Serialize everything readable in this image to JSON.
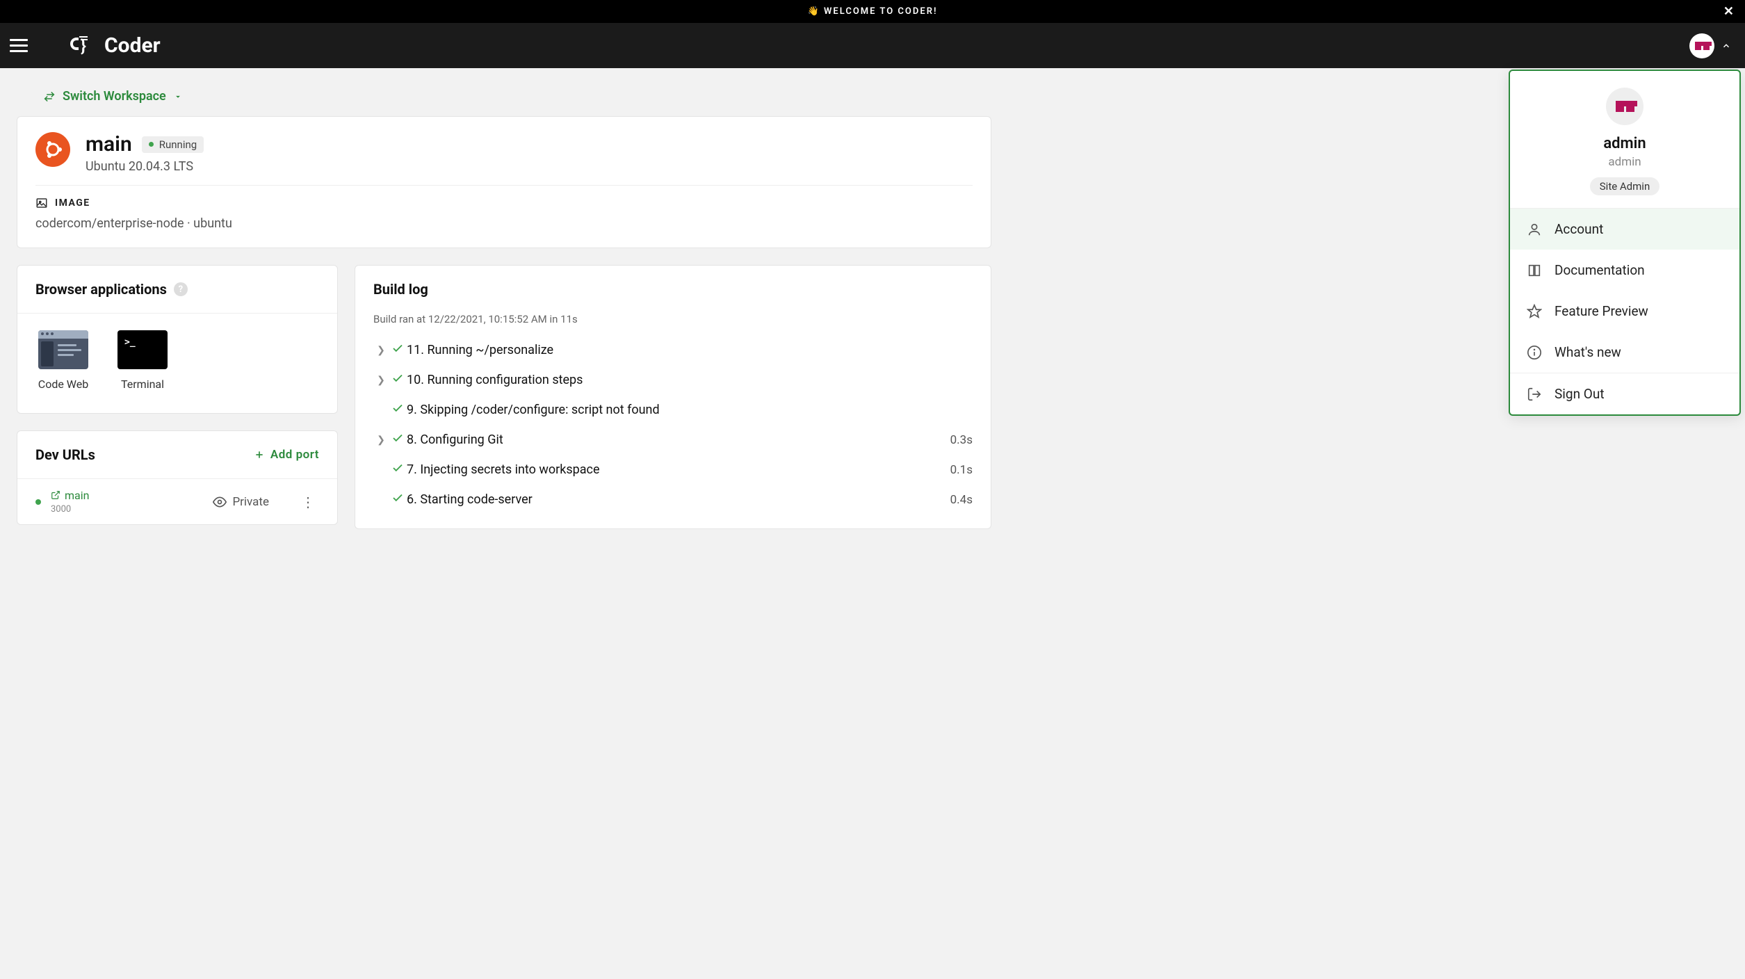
{
  "welcome_bar": {
    "emoji": "👋",
    "text": "WELCOME TO CODER!"
  },
  "brand": "Coder",
  "switch_workspace_label": "Switch Workspace",
  "workspace": {
    "name": "main",
    "status": "Running",
    "os": "Ubuntu 20.04.3 LTS",
    "image_label": "IMAGE",
    "image_value": "codercom/enterprise-node · ubuntu"
  },
  "browser_apps": {
    "title": "Browser applications",
    "items": [
      {
        "label": "Code Web"
      },
      {
        "label": "Terminal"
      }
    ]
  },
  "dev_urls": {
    "title": "Dev URLs",
    "add_label": "Add port",
    "items": [
      {
        "name": "main",
        "port": "3000",
        "privacy": "Private"
      }
    ]
  },
  "build_log": {
    "title": "Build log",
    "meta": "Build ran at 12/22/2021, 10:15:52 AM in 11s",
    "steps": [
      {
        "expandable": true,
        "label": "11. Running ~/personalize",
        "time": ""
      },
      {
        "expandable": true,
        "label": "10. Running configuration steps",
        "time": ""
      },
      {
        "expandable": false,
        "label": "9. Skipping /coder/configure: script not found",
        "time": ""
      },
      {
        "expandable": true,
        "label": "8. Configuring Git",
        "time": "0.3s"
      },
      {
        "expandable": false,
        "label": "7. Injecting secrets into workspace",
        "time": "0.1s"
      },
      {
        "expandable": false,
        "label": "6. Starting code-server",
        "time": "0.4s"
      }
    ]
  },
  "user_menu": {
    "name": "admin",
    "login": "admin",
    "role": "Site Admin",
    "items": [
      {
        "icon": "account",
        "label": "Account",
        "active": true
      },
      {
        "icon": "book",
        "label": "Documentation"
      },
      {
        "icon": "star",
        "label": "Feature Preview"
      },
      {
        "icon": "info",
        "label": "What's new"
      }
    ],
    "signout": "Sign Out"
  }
}
